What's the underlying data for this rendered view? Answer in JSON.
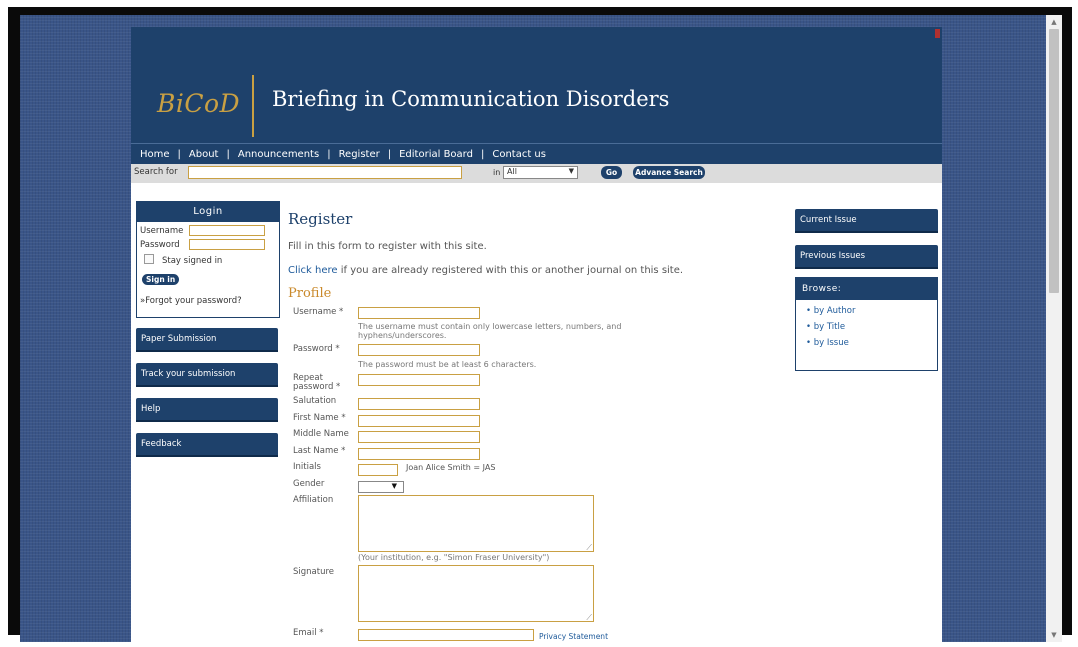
{
  "site": {
    "logo": "BiCoD",
    "title": "Briefing in Communication Disorders"
  },
  "nav": {
    "items": [
      "Home",
      "About",
      "Announcements",
      "Register",
      "Editorial Board",
      "Contact us"
    ],
    "separator": "|"
  },
  "search": {
    "label": "Search  for",
    "in_label": "in",
    "field_value": "All",
    "go_label": "Go",
    "advanced_label": "Advance Search"
  },
  "login": {
    "title": "Login",
    "username_label": "Username",
    "password_label": "Password",
    "stay_label": "Stay signed in",
    "signin_label": "Sign in",
    "forgot_label": "»Forgot your password?"
  },
  "left_menu": [
    "Paper Submission",
    "Track your submission",
    "Help",
    "Feedback"
  ],
  "main": {
    "heading": "Register",
    "intro": "Fill in this form to register with this site.",
    "click_here": "Click here",
    "click_rest": " if you are already registered with this or another journal on this site.",
    "profile_heading": "Profile",
    "fields": {
      "username": "Username *",
      "username_hint": "The username must contain only lowercase letters, numbers, and hyphens/underscores.",
      "password": "Password *",
      "password_hint": "The password must be at least 6 characters.",
      "repeat_password": "Repeat password *",
      "salutation": "Salutation",
      "first_name": "First Name *",
      "middle_name": "Middle Name",
      "last_name": "Last Name *",
      "initials": "Initials",
      "initials_hint": "Joan Alice Smith = JAS",
      "gender": "Gender",
      "affiliation": "Affiliation",
      "affiliation_hint": "(Your institution, e.g. \"Simon Fraser University\")",
      "signature": "Signature",
      "email": "Email *",
      "privacy": "Privacy Statement"
    }
  },
  "right_menu": {
    "current_issue": "Current Issue",
    "previous_issues": "Previous Issues",
    "browse_title": "Browse:",
    "browse_items": [
      "by Author",
      "by Title",
      "by Issue"
    ]
  },
  "colors": {
    "brand_navy": "#1e416b",
    "accent_gold": "#c9a043",
    "background_blue": "#3a5588"
  }
}
